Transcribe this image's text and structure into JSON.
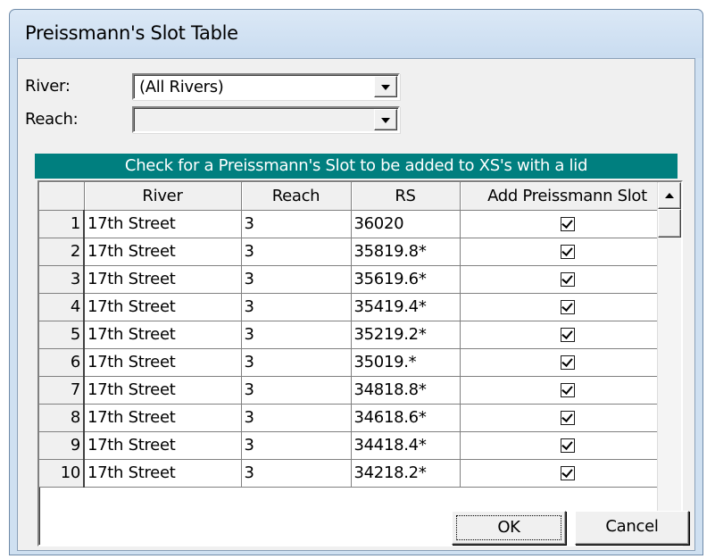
{
  "window": {
    "title": "Preissmann's Slot Table"
  },
  "filters": {
    "river_label": "River:",
    "river_value": "(All Rivers)",
    "reach_label": "Reach:",
    "reach_value": ""
  },
  "banner": "Check for a Preissmann's Slot to be added to XS's with a lid",
  "table": {
    "columns": [
      "",
      "River",
      "Reach",
      "RS",
      "Add Preissmann Slot"
    ],
    "rows": [
      {
        "num": "1",
        "river": "17th Street",
        "reach": "3",
        "rs": "36020",
        "checked": true
      },
      {
        "num": "2",
        "river": "17th Street",
        "reach": "3",
        "rs": "35819.8*",
        "checked": true
      },
      {
        "num": "3",
        "river": "17th Street",
        "reach": "3",
        "rs": "35619.6*",
        "checked": true
      },
      {
        "num": "4",
        "river": "17th Street",
        "reach": "3",
        "rs": "35419.4*",
        "checked": true
      },
      {
        "num": "5",
        "river": "17th Street",
        "reach": "3",
        "rs": "35219.2*",
        "checked": true
      },
      {
        "num": "6",
        "river": "17th Street",
        "reach": "3",
        "rs": "35019.*",
        "checked": true
      },
      {
        "num": "7",
        "river": "17th Street",
        "reach": "3",
        "rs": "34818.8*",
        "checked": true
      },
      {
        "num": "8",
        "river": "17th Street",
        "reach": "3",
        "rs": "34618.6*",
        "checked": true
      },
      {
        "num": "9",
        "river": "17th Street",
        "reach": "3",
        "rs": "34418.4*",
        "checked": true
      },
      {
        "num": "10",
        "river": "17th Street",
        "reach": "3",
        "rs": "34218.2*",
        "checked": true
      }
    ]
  },
  "buttons": {
    "ok": "OK",
    "cancel": "Cancel"
  },
  "colors": {
    "banner_bg": "#007f7f",
    "banner_text": "#ffffff",
    "window_frame": "#cfe0f1"
  },
  "icons": {
    "dropdown": "chevron-down-icon",
    "scroll_up": "arrow-up-icon",
    "scroll_down": "arrow-down-icon",
    "checkbox": "checkbox-checked-icon"
  }
}
